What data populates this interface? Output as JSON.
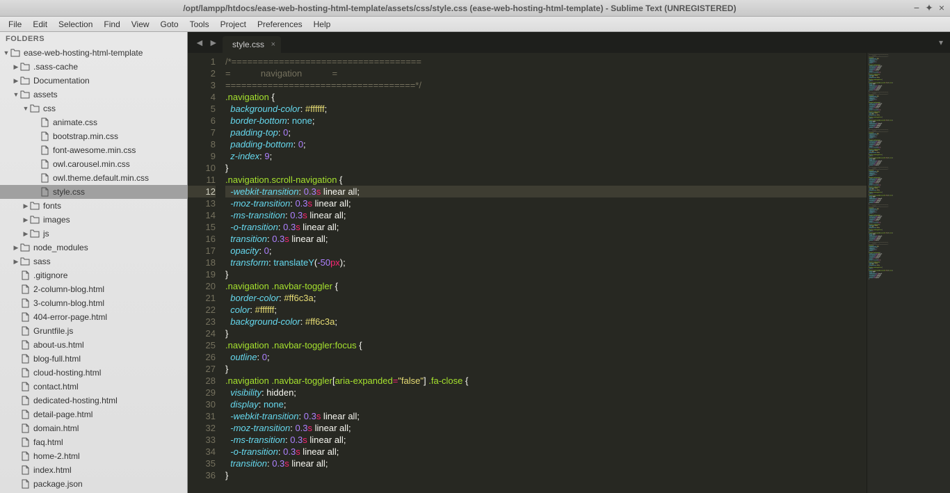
{
  "window": {
    "title": "/opt/lampp/htdocs/ease-web-hosting-html-template/assets/css/style.css (ease-web-hosting-html-template) - Sublime Text (UNREGISTERED)"
  },
  "menu": [
    "File",
    "Edit",
    "Selection",
    "Find",
    "View",
    "Goto",
    "Tools",
    "Project",
    "Preferences",
    "Help"
  ],
  "sidebar": {
    "header": "FOLDERS",
    "tree": [
      {
        "depth": 0,
        "type": "folder",
        "open": true,
        "label": "ease-web-hosting-html-template"
      },
      {
        "depth": 1,
        "type": "folder",
        "open": false,
        "label": ".sass-cache"
      },
      {
        "depth": 1,
        "type": "folder",
        "open": false,
        "label": "Documentation"
      },
      {
        "depth": 1,
        "type": "folder",
        "open": true,
        "label": "assets"
      },
      {
        "depth": 2,
        "type": "folder",
        "open": true,
        "label": "css"
      },
      {
        "depth": 3,
        "type": "file",
        "label": "animate.css"
      },
      {
        "depth": 3,
        "type": "file",
        "label": "bootstrap.min.css"
      },
      {
        "depth": 3,
        "type": "file",
        "label": "font-awesome.min.css"
      },
      {
        "depth": 3,
        "type": "file",
        "label": "owl.carousel.min.css"
      },
      {
        "depth": 3,
        "type": "file",
        "label": "owl.theme.default.min.css"
      },
      {
        "depth": 3,
        "type": "file",
        "label": "style.css",
        "selected": true
      },
      {
        "depth": 2,
        "type": "folder",
        "open": false,
        "label": "fonts"
      },
      {
        "depth": 2,
        "type": "folder",
        "open": false,
        "label": "images"
      },
      {
        "depth": 2,
        "type": "folder",
        "open": false,
        "label": "js"
      },
      {
        "depth": 1,
        "type": "folder",
        "open": false,
        "label": "node_modules"
      },
      {
        "depth": 1,
        "type": "folder",
        "open": false,
        "label": "sass"
      },
      {
        "depth": 1,
        "type": "file",
        "label": ".gitignore"
      },
      {
        "depth": 1,
        "type": "file",
        "label": "2-column-blog.html"
      },
      {
        "depth": 1,
        "type": "file",
        "label": "3-column-blog.html"
      },
      {
        "depth": 1,
        "type": "file",
        "label": "404-error-page.html"
      },
      {
        "depth": 1,
        "type": "file",
        "label": "Gruntfile.js"
      },
      {
        "depth": 1,
        "type": "file",
        "label": "about-us.html"
      },
      {
        "depth": 1,
        "type": "file",
        "label": "blog-full.html"
      },
      {
        "depth": 1,
        "type": "file",
        "label": "cloud-hosting.html"
      },
      {
        "depth": 1,
        "type": "file",
        "label": "contact.html"
      },
      {
        "depth": 1,
        "type": "file",
        "label": "dedicated-hosting.html"
      },
      {
        "depth": 1,
        "type": "file",
        "label": "detail-page.html"
      },
      {
        "depth": 1,
        "type": "file",
        "label": "domain.html"
      },
      {
        "depth": 1,
        "type": "file",
        "label": "faq.html"
      },
      {
        "depth": 1,
        "type": "file",
        "label": "home-2.html"
      },
      {
        "depth": 1,
        "type": "file",
        "label": "index.html"
      },
      {
        "depth": 1,
        "type": "file",
        "label": "package.json"
      }
    ]
  },
  "tab": {
    "label": "style.css"
  },
  "highlight_line": 12,
  "fold_markers": [
    11,
    19
  ],
  "code_lines": [
    {
      "n": 1,
      "t": [
        [
          "cmt",
          "/*===================================="
        ]
      ]
    },
    {
      "n": 2,
      "t": [
        [
          "cmt",
          "=            navigation            ="
        ]
      ]
    },
    {
      "n": 3,
      "t": [
        [
          "cmt",
          "====================================*/"
        ]
      ]
    },
    {
      "n": 4,
      "t": [
        [
          "sel",
          ".navigation"
        ],
        [
          "punc",
          " {"
        ]
      ]
    },
    {
      "n": 5,
      "t": [
        [
          "",
          "  "
        ],
        [
          "prop",
          "background-color"
        ],
        [
          "punc",
          ": "
        ],
        [
          "str",
          "#ffffff"
        ],
        [
          "punc",
          ";"
        ]
      ]
    },
    {
      "n": 6,
      "t": [
        [
          "",
          "  "
        ],
        [
          "prop",
          "border-bottom"
        ],
        [
          "punc",
          ": "
        ],
        [
          "kw",
          "none"
        ],
        [
          "punc",
          ";"
        ]
      ]
    },
    {
      "n": 7,
      "t": [
        [
          "",
          "  "
        ],
        [
          "prop",
          "padding-top"
        ],
        [
          "punc",
          ": "
        ],
        [
          "num",
          "0"
        ],
        [
          "punc",
          ";"
        ]
      ]
    },
    {
      "n": 8,
      "t": [
        [
          "",
          "  "
        ],
        [
          "prop",
          "padding-bottom"
        ],
        [
          "punc",
          ": "
        ],
        [
          "num",
          "0"
        ],
        [
          "punc",
          ";"
        ]
      ]
    },
    {
      "n": 9,
      "t": [
        [
          "",
          "  "
        ],
        [
          "prop",
          "z-index"
        ],
        [
          "punc",
          ": "
        ],
        [
          "num",
          "9"
        ],
        [
          "punc",
          ";"
        ]
      ]
    },
    {
      "n": 10,
      "t": [
        [
          "punc",
          "}"
        ]
      ]
    },
    {
      "n": 11,
      "t": [
        [
          "sel",
          ".navigation.scroll-navigation"
        ],
        [
          "punc",
          " {"
        ]
      ]
    },
    {
      "n": 12,
      "t": [
        [
          "",
          "  "
        ],
        [
          "prop",
          "-webkit-transition"
        ],
        [
          "punc",
          ": "
        ],
        [
          "num",
          "0.3"
        ],
        [
          "unit",
          "s"
        ],
        [
          "punc",
          " linear all;"
        ]
      ]
    },
    {
      "n": 13,
      "t": [
        [
          "",
          "  "
        ],
        [
          "prop",
          "-moz-transition"
        ],
        [
          "punc",
          ": "
        ],
        [
          "num",
          "0.3"
        ],
        [
          "unit",
          "s"
        ],
        [
          "punc",
          " linear all;"
        ]
      ]
    },
    {
      "n": 14,
      "t": [
        [
          "",
          "  "
        ],
        [
          "prop",
          "-ms-transition"
        ],
        [
          "punc",
          ": "
        ],
        [
          "num",
          "0.3"
        ],
        [
          "unit",
          "s"
        ],
        [
          "punc",
          " linear all;"
        ]
      ]
    },
    {
      "n": 15,
      "t": [
        [
          "",
          "  "
        ],
        [
          "prop",
          "-o-transition"
        ],
        [
          "punc",
          ": "
        ],
        [
          "num",
          "0.3"
        ],
        [
          "unit",
          "s"
        ],
        [
          "punc",
          " linear all;"
        ]
      ]
    },
    {
      "n": 16,
      "t": [
        [
          "",
          "  "
        ],
        [
          "prop",
          "transition"
        ],
        [
          "punc",
          ": "
        ],
        [
          "num",
          "0.3"
        ],
        [
          "unit",
          "s"
        ],
        [
          "punc",
          " linear all;"
        ]
      ]
    },
    {
      "n": 17,
      "t": [
        [
          "",
          "  "
        ],
        [
          "prop",
          "opacity"
        ],
        [
          "punc",
          ": "
        ],
        [
          "num",
          "0"
        ],
        [
          "punc",
          ";"
        ]
      ]
    },
    {
      "n": 18,
      "t": [
        [
          "",
          "  "
        ],
        [
          "prop",
          "transform"
        ],
        [
          "punc",
          ": "
        ],
        [
          "func",
          "translateY"
        ],
        [
          "punc",
          "("
        ],
        [
          "num",
          "-50"
        ],
        [
          "unit",
          "px"
        ],
        [
          "punc",
          ");"
        ]
      ]
    },
    {
      "n": 19,
      "t": [
        [
          "punc",
          "}"
        ]
      ]
    },
    {
      "n": 20,
      "t": [
        [
          "sel",
          ".navigation "
        ],
        [
          "sel",
          ".navbar-toggler"
        ],
        [
          "punc",
          " {"
        ]
      ]
    },
    {
      "n": 21,
      "t": [
        [
          "",
          "  "
        ],
        [
          "prop",
          "border-color"
        ],
        [
          "punc",
          ": "
        ],
        [
          "str",
          "#ff6c3a"
        ],
        [
          "punc",
          ";"
        ]
      ]
    },
    {
      "n": 22,
      "t": [
        [
          "",
          "  "
        ],
        [
          "prop",
          "color"
        ],
        [
          "punc",
          ": "
        ],
        [
          "str",
          "#ffffff"
        ],
        [
          "punc",
          ";"
        ]
      ]
    },
    {
      "n": 23,
      "t": [
        [
          "",
          "  "
        ],
        [
          "prop",
          "background-color"
        ],
        [
          "punc",
          ": "
        ],
        [
          "str",
          "#ff6c3a"
        ],
        [
          "punc",
          ";"
        ]
      ]
    },
    {
      "n": 24,
      "t": [
        [
          "punc",
          "}"
        ]
      ]
    },
    {
      "n": 25,
      "t": [
        [
          "sel",
          ".navigation "
        ],
        [
          "sel",
          ".navbar-toggler"
        ],
        [
          "ps",
          ":focus"
        ],
        [
          "punc",
          " {"
        ]
      ]
    },
    {
      "n": 26,
      "t": [
        [
          "",
          "  "
        ],
        [
          "prop",
          "outline"
        ],
        [
          "punc",
          ": "
        ],
        [
          "num",
          "0"
        ],
        [
          "punc",
          ";"
        ]
      ]
    },
    {
      "n": 27,
      "t": [
        [
          "punc",
          "}"
        ]
      ]
    },
    {
      "n": 28,
      "t": [
        [
          "sel",
          ".navigation "
        ],
        [
          "sel",
          ".navbar-toggler"
        ],
        [
          "punc",
          "["
        ],
        [
          "attr",
          "aria-expanded"
        ],
        [
          "op",
          "="
        ],
        [
          "str",
          "\"false\""
        ],
        [
          "punc",
          "] "
        ],
        [
          "sel",
          ".fa-close"
        ],
        [
          "punc",
          " {"
        ]
      ]
    },
    {
      "n": 29,
      "t": [
        [
          "",
          "  "
        ],
        [
          "prop",
          "visibility"
        ],
        [
          "punc",
          ": hidden;"
        ]
      ]
    },
    {
      "n": 30,
      "t": [
        [
          "",
          "  "
        ],
        [
          "prop",
          "display"
        ],
        [
          "punc",
          ": "
        ],
        [
          "kw",
          "none"
        ],
        [
          "punc",
          ";"
        ]
      ]
    },
    {
      "n": 31,
      "t": [
        [
          "",
          "  "
        ],
        [
          "prop",
          "-webkit-transition"
        ],
        [
          "punc",
          ": "
        ],
        [
          "num",
          "0.3"
        ],
        [
          "unit",
          "s"
        ],
        [
          "punc",
          " linear all;"
        ]
      ]
    },
    {
      "n": 32,
      "t": [
        [
          "",
          "  "
        ],
        [
          "prop",
          "-moz-transition"
        ],
        [
          "punc",
          ": "
        ],
        [
          "num",
          "0.3"
        ],
        [
          "unit",
          "s"
        ],
        [
          "punc",
          " linear all;"
        ]
      ]
    },
    {
      "n": 33,
      "t": [
        [
          "",
          "  "
        ],
        [
          "prop",
          "-ms-transition"
        ],
        [
          "punc",
          ": "
        ],
        [
          "num",
          "0.3"
        ],
        [
          "unit",
          "s"
        ],
        [
          "punc",
          " linear all;"
        ]
      ]
    },
    {
      "n": 34,
      "t": [
        [
          "",
          "  "
        ],
        [
          "prop",
          "-o-transition"
        ],
        [
          "punc",
          ": "
        ],
        [
          "num",
          "0.3"
        ],
        [
          "unit",
          "s"
        ],
        [
          "punc",
          " linear all;"
        ]
      ]
    },
    {
      "n": 35,
      "t": [
        [
          "",
          "  "
        ],
        [
          "prop",
          "transition"
        ],
        [
          "punc",
          ": "
        ],
        [
          "num",
          "0.3"
        ],
        [
          "unit",
          "s"
        ],
        [
          "punc",
          " linear all;"
        ]
      ]
    },
    {
      "n": 36,
      "t": [
        [
          "punc",
          "}"
        ]
      ]
    }
  ]
}
